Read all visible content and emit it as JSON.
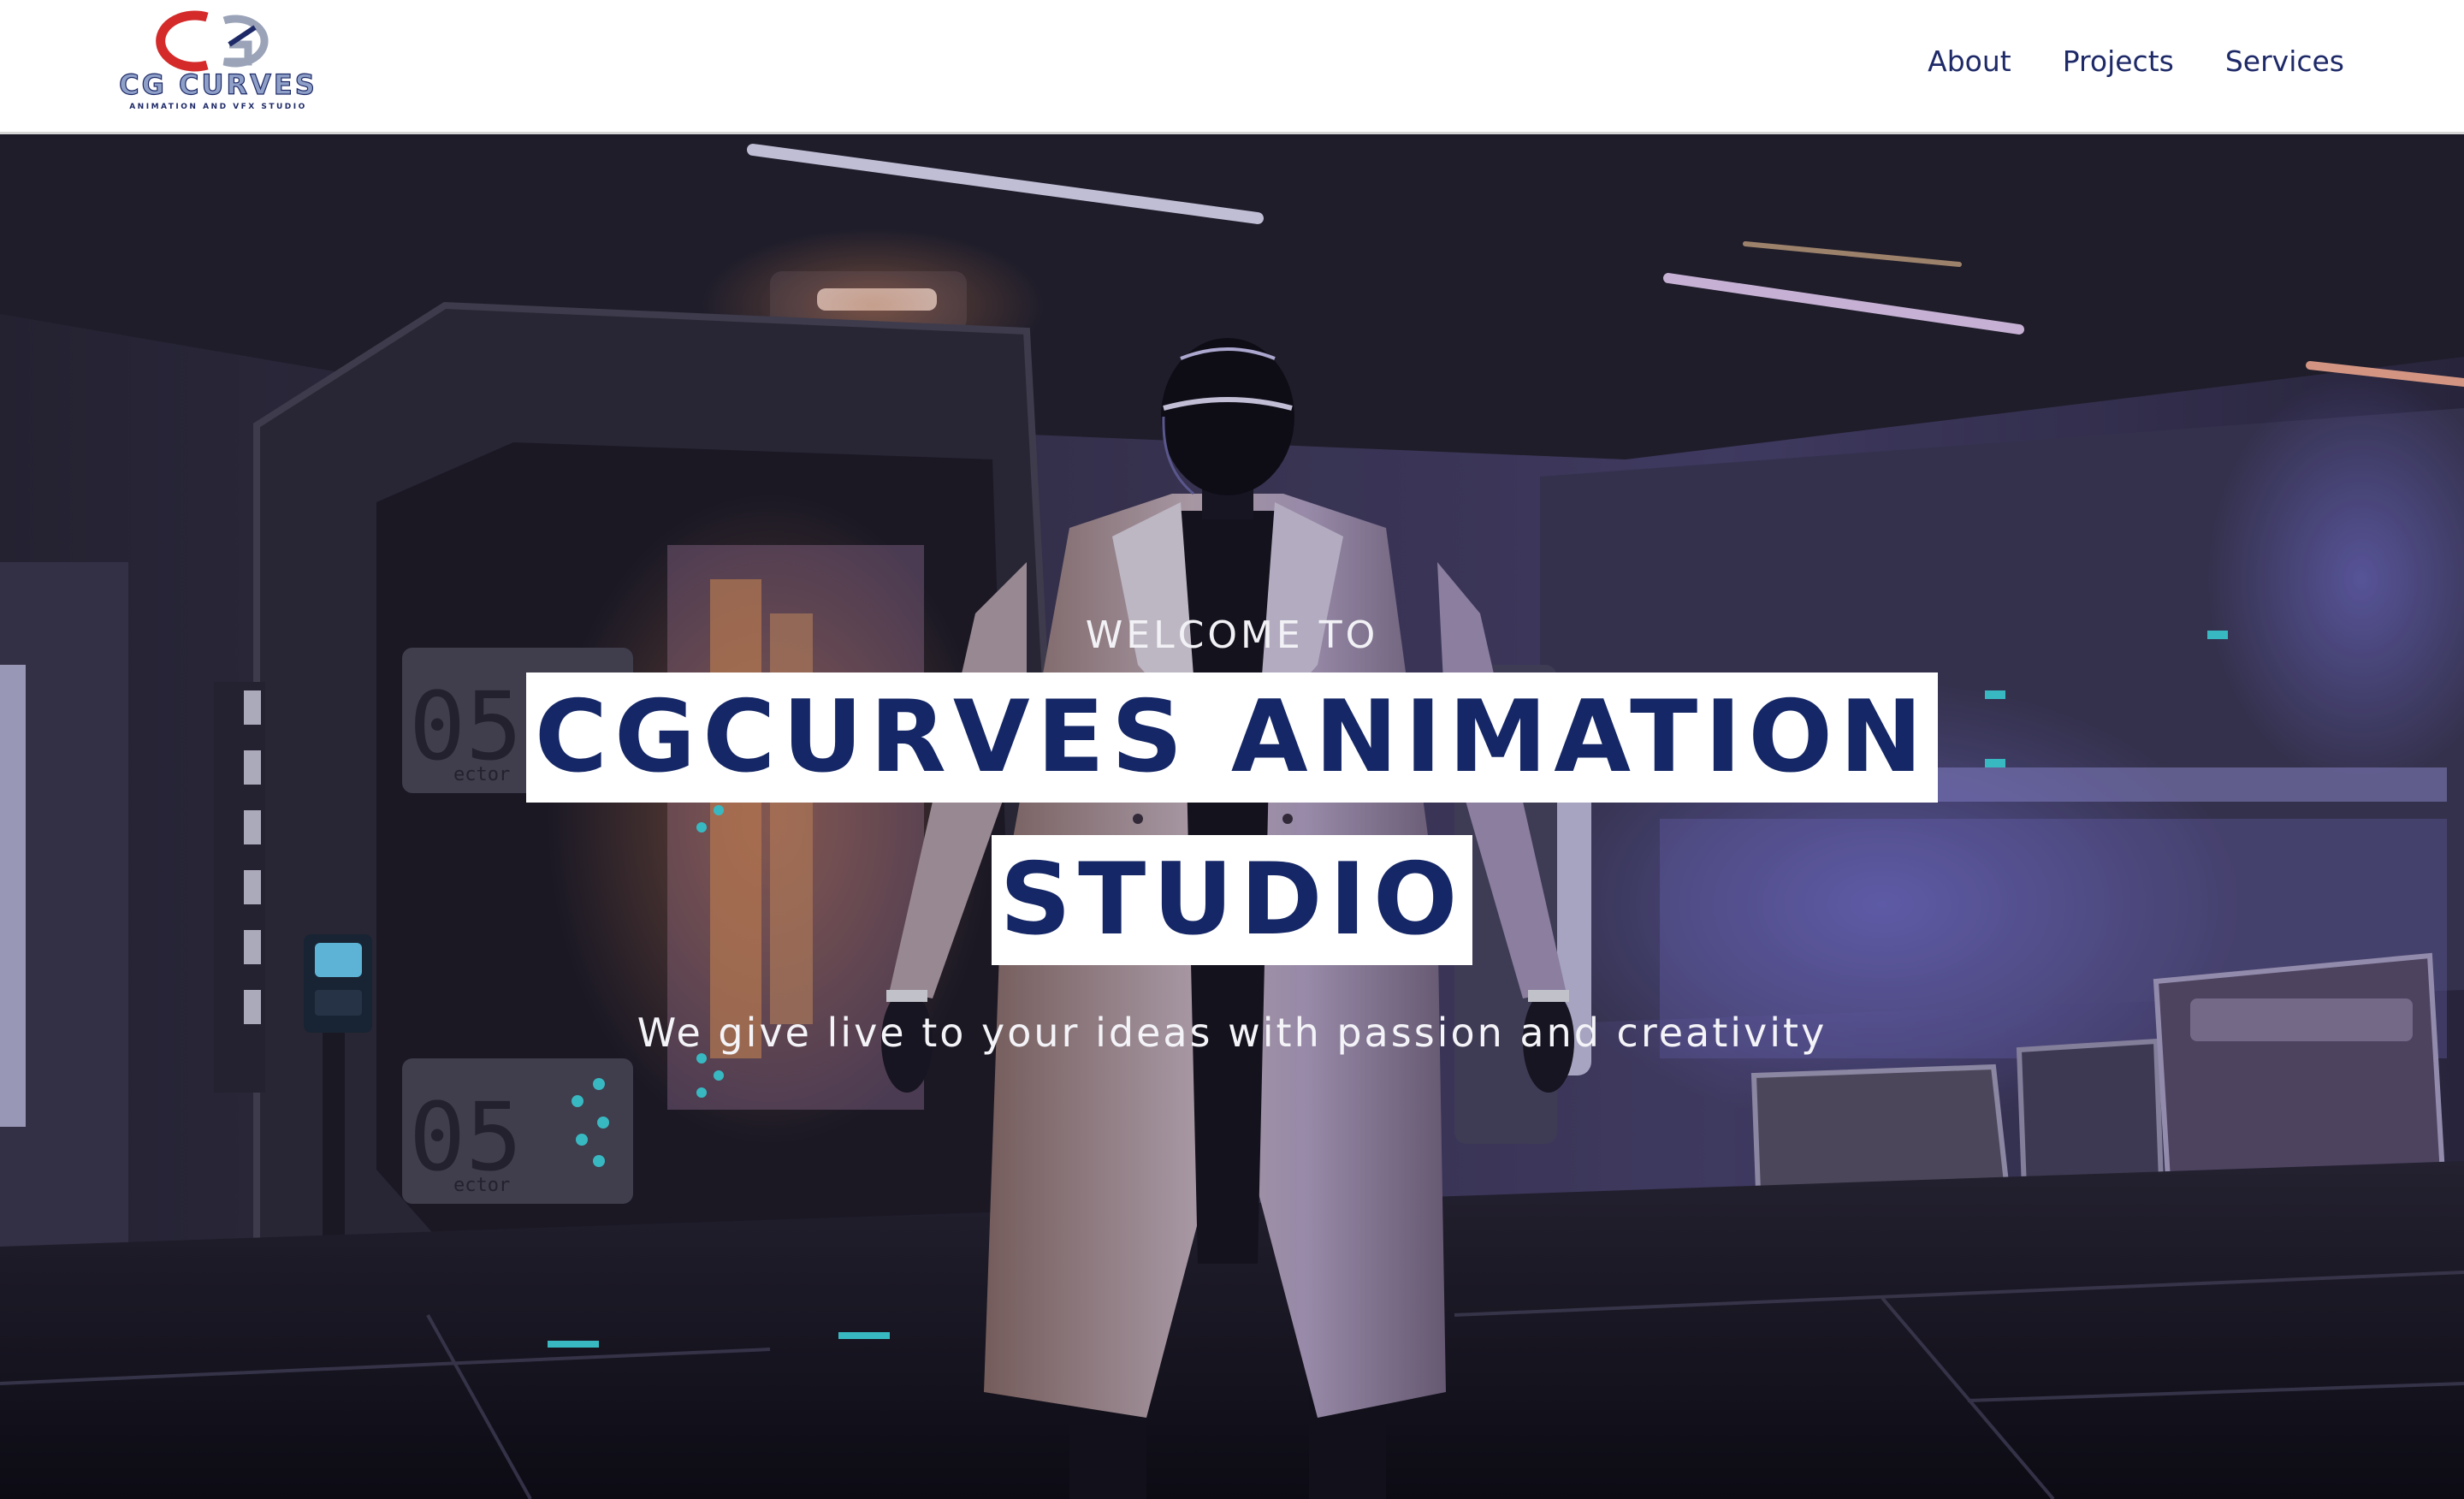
{
  "brand": {
    "logo_text": "CG CURVES",
    "logo_subtext": "ANIMATION AND VFX STUDIO",
    "accent_red": "#d42a2a",
    "accent_navy": "#1e2a68"
  },
  "nav": {
    "items": [
      {
        "label": "About"
      },
      {
        "label": "Projects"
      },
      {
        "label": "Services"
      }
    ]
  },
  "hero": {
    "welcome": "WELCOME TO",
    "title_line1": "CGCURVES ANIMATION",
    "title_line2": "STUDIO",
    "tagline": "We give live to your ideas with passion and creativity",
    "background": "sci-fi corridor with robot in white trench coat",
    "door_label": "05",
    "door_caption": "ector"
  }
}
